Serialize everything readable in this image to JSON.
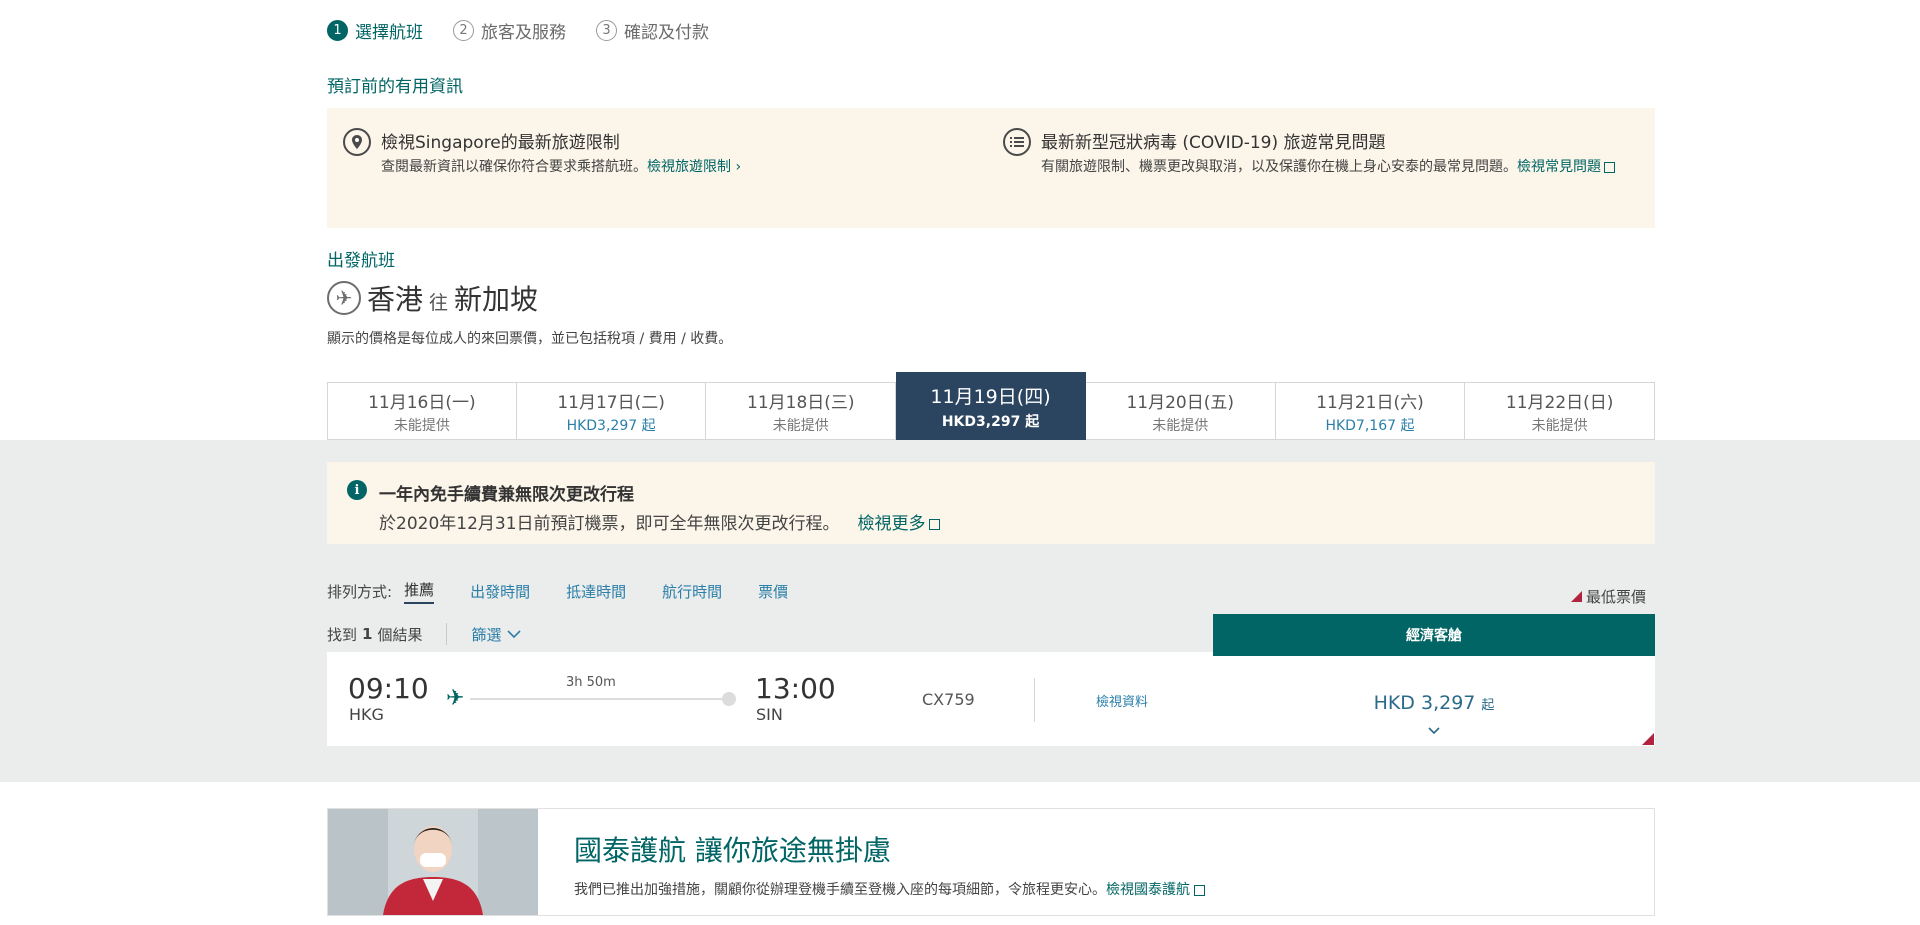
{
  "steps": [
    {
      "num": "1",
      "label": "選擇航班"
    },
    {
      "num": "2",
      "label": "旅客及服務"
    },
    {
      "num": "3",
      "label": "確認及付款"
    }
  ],
  "useful_info": {
    "title": "預訂前的有用資訊",
    "left": {
      "title": "檢視Singapore的最新旅遊限制",
      "text": "查閱最新資訊以確保你符合要求乘搭航班。",
      "link": "檢視旅遊限制 ›"
    },
    "right": {
      "title": "最新新型冠狀病毒 (COVID-19) 旅遊常見問題",
      "text": "有關旅遊限制、機票更改與取消，以及保護你在機上身心安泰的最常見問題。",
      "link": "檢視常見問題"
    }
  },
  "outbound": {
    "label": "出發航班",
    "origin": "香港",
    "to_word": "往",
    "destination": "新加坡",
    "price_note": "顯示的價格是每位成人的來回票價，並已包括稅項 / 費用 / 收費。"
  },
  "date_tabs": [
    {
      "date": "11月16日(一)",
      "price": "未能提供",
      "available": false,
      "active": false
    },
    {
      "date": "11月17日(二)",
      "price": "HKD3,297 起",
      "available": true,
      "active": false
    },
    {
      "date": "11月18日(三)",
      "price": "未能提供",
      "available": false,
      "active": false
    },
    {
      "date": "11月19日(四)",
      "price": "HKD3,297 起",
      "available": true,
      "active": true
    },
    {
      "date": "11月20日(五)",
      "price": "未能提供",
      "available": false,
      "active": false
    },
    {
      "date": "11月21日(六)",
      "price": "HKD7,167 起",
      "available": true,
      "active": false
    },
    {
      "date": "11月22日(日)",
      "price": "未能提供",
      "available": false,
      "active": false
    }
  ],
  "promo": {
    "title": "一年內免手續費兼無限次更改行程",
    "text": "於2020年12月31日前預訂機票，即可全年無限次更改行程。",
    "link": "檢視更多"
  },
  "sort": {
    "label": "排列方式:",
    "options": [
      "推薦",
      "出發時間",
      "抵達時間",
      "航行時間",
      "票價"
    ],
    "lowest_fare": "最低票價"
  },
  "results": {
    "prefix": "找到",
    "count": "1",
    "suffix": "個結果",
    "filter": "篩選"
  },
  "cabin": {
    "label": "經濟客艙"
  },
  "flight": {
    "dep_time": "09:10",
    "dep_code": "HKG",
    "duration": "3h 50m",
    "arr_time": "13:00",
    "arr_code": "SIN",
    "flight_no": "CX759",
    "details": "檢視資料",
    "price": "HKD 3,297",
    "price_suffix": "起"
  },
  "banner": {
    "title": "國泰護航 讓你旅途無掛慮",
    "text": "我們已推出加強措施，關顧你從辦理登機手續至登機入座的每項細節，令旅程更安心。",
    "link": "檢視國泰護航"
  },
  "colors": {
    "brand": "#006564",
    "active_tab": "#2b4460",
    "link_blue": "#2b7fa8",
    "lowest_fare_marker": "#b1233f",
    "info_bg": "#fbf5ea"
  }
}
